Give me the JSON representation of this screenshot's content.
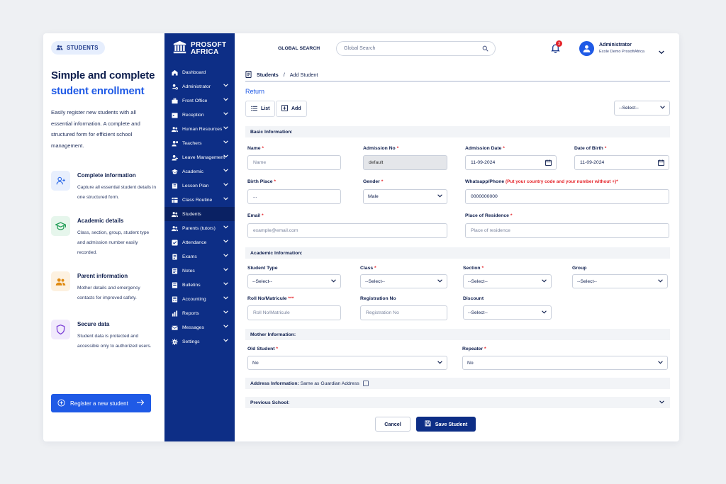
{
  "promo": {
    "badge": "STUDENTS",
    "title_line1": "Simple and complete",
    "title_line2": "student enrollment",
    "lead": "Easily register new students with all essential information. A complete and structured form for efficient school management.",
    "features": [
      {
        "title": "Complete information",
        "desc": "Capture all essential student details in one structured form.",
        "icon": "user-plus-icon",
        "color": "#2d6ae8",
        "bg": "#e8effd"
      },
      {
        "title": "Academic details",
        "desc": "Class, section, group, student type and admission number easily recorded.",
        "icon": "graduation-cap-icon",
        "color": "#1f9d55",
        "bg": "#e6f6ec"
      },
      {
        "title": "Parent information",
        "desc": "Mother details and emergency contacts for improved safety.",
        "icon": "users-icon",
        "color": "#e08a12",
        "bg": "#fdf1e0"
      },
      {
        "title": "Secure data",
        "desc": "Student data is protected and accessible only to authorized users.",
        "icon": "shield-icon",
        "color": "#7b3fd6",
        "bg": "#f1eafc"
      }
    ],
    "cta": "Register a new student"
  },
  "brand": {
    "line1": "PROSOFT",
    "line2": "AFRICA"
  },
  "nav": [
    {
      "label": "Dashboard",
      "icon": "home-icon",
      "chevron": false
    },
    {
      "label": "Administrator",
      "icon": "user-cog-icon",
      "chevron": true
    },
    {
      "label": "Front Office",
      "icon": "briefcase-icon",
      "chevron": true
    },
    {
      "label": "Reception",
      "icon": "calendar-icon",
      "chevron": true
    },
    {
      "label": "Human Resources",
      "icon": "users-icon",
      "chevron": true
    },
    {
      "label": "Teachers",
      "icon": "teacher-icon",
      "chevron": true
    },
    {
      "label": "Leave Management",
      "icon": "leave-icon",
      "chevron": true
    },
    {
      "label": "Academic",
      "icon": "graduation-cap-icon",
      "chevron": true
    },
    {
      "label": "Lesson Plan",
      "icon": "book-icon",
      "chevron": true
    },
    {
      "label": "Class Routine",
      "icon": "table-icon",
      "chevron": true
    },
    {
      "label": "Students",
      "icon": "students-icon",
      "chevron": false,
      "active": true
    },
    {
      "label": "Parents (tutors)",
      "icon": "parents-icon",
      "chevron": true
    },
    {
      "label": "Attendance",
      "icon": "check-square-icon",
      "chevron": true
    },
    {
      "label": "Exams",
      "icon": "exam-icon",
      "chevron": true
    },
    {
      "label": "Notes",
      "icon": "note-icon",
      "chevron": true
    },
    {
      "label": "Bulletins",
      "icon": "bulletin-icon",
      "chevron": true
    },
    {
      "label": "Accounting",
      "icon": "accounting-icon",
      "chevron": true
    },
    {
      "label": "Reports",
      "icon": "chart-icon",
      "chevron": true
    },
    {
      "label": "Messages",
      "icon": "mail-icon",
      "chevron": true
    },
    {
      "label": "Settings",
      "icon": "gear-icon",
      "chevron": true
    }
  ],
  "topbar": {
    "search_label": "GLOBAL SEARCH",
    "search_placeholder": "Global Search",
    "notif_count": "3",
    "user_name": "Administrator",
    "user_org": "Ecole Demo ProsoftAfrica"
  },
  "crumb": {
    "section": "Students",
    "sep": "/",
    "page": "Add Student"
  },
  "return_label": "Return",
  "toolbar": {
    "list": "List",
    "add": "Add",
    "filter_value": "--Select--"
  },
  "basic": {
    "title": "Basic Information:",
    "name_label": "Name",
    "name_placeholder": "Name",
    "admission_no_label": "Admission No",
    "admission_no_value": "default",
    "admission_date_label": "Admission Date",
    "admission_date_value": "11-09-2024",
    "dob_label": "Date of Birth",
    "dob_value": "11-09-2024",
    "birth_place_label": "Birth Place",
    "birth_place_value": "...",
    "gender_label": "Gender",
    "gender_value": "Male",
    "phone_label": "Whatsapp/Phone",
    "phone_note": "(Put your country code and your number without +)",
    "phone_value": "0000000000",
    "email_label": "Email",
    "email_placeholder": "example@email.com",
    "residence_label": "Place of Residence",
    "residence_placeholder": "Place of residence"
  },
  "academic": {
    "title": "Academic Information:",
    "student_type_label": "Student Type",
    "student_type_value": "--Select--",
    "class_label": "Class",
    "class_value": "--Select--",
    "section_label": "Section",
    "section_value": "--Select--",
    "group_label": "Group",
    "group_value": "--Select--",
    "roll_label": "Roll No/Matricule",
    "roll_placeholder": "Roll No/Matricule",
    "reg_label": "Registration No",
    "reg_placeholder": "Registration No",
    "discount_label": "Discount",
    "discount_value": "--Select--"
  },
  "mother": {
    "title": "Mother Information:",
    "old_student_label": "Old Student",
    "old_student_value": "No",
    "repeater_label": "Repeater",
    "repeater_value": "No"
  },
  "address": {
    "title": "Address Information:",
    "same_as": "Same as Guardian Address"
  },
  "previous_school": {
    "title": "Previous School:"
  },
  "actions": {
    "cancel": "Cancel",
    "save": "Save Student"
  },
  "required_mark": "*",
  "required_mark_triple": "***"
}
